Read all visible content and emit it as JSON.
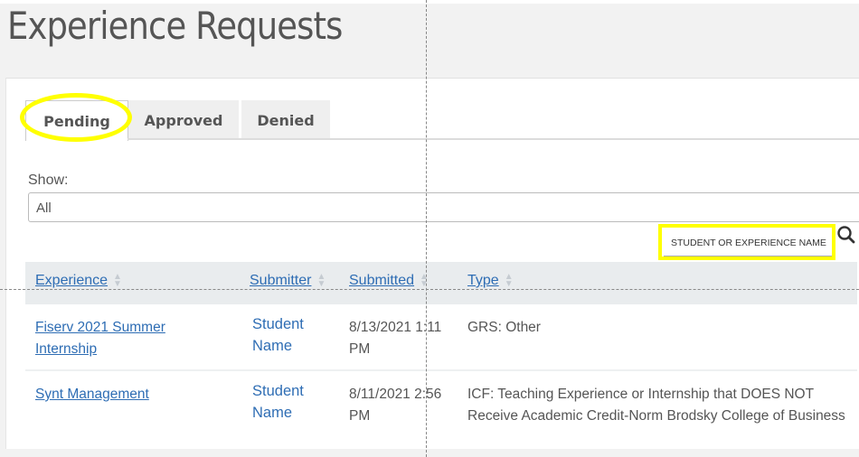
{
  "page": {
    "title": "Experience Requests"
  },
  "tabs": [
    {
      "label": "Pending",
      "active": true
    },
    {
      "label": "Approved",
      "active": false
    },
    {
      "label": "Denied",
      "active": false
    }
  ],
  "filter": {
    "label": "Show:",
    "selected": "All"
  },
  "search": {
    "placeholder": "STUDENT OR EXPERIENCE NAME",
    "icon": "search-icon"
  },
  "table": {
    "columns": [
      {
        "label": "Experience",
        "sortable": true
      },
      {
        "label": "Submitter",
        "sortable": true
      },
      {
        "label": "Submitted",
        "sortable": true
      },
      {
        "label": "Type",
        "sortable": true
      }
    ],
    "rows": [
      {
        "experience": "Fiserv 2021 Summer Internship",
        "submitter": "Student Name",
        "submitted": "8/13/2021 1:11 PM",
        "type": "GRS: Other"
      },
      {
        "experience": "Synt Management",
        "submitter": "Student Name",
        "submitted": "8/11/2021 2:56 PM",
        "type": "ICF: Teaching Experience or Internship that DOES NOT Receive Academic Credit-Norm Brodsky College of Business"
      }
    ]
  },
  "colors": {
    "link": "#2e6db4",
    "highlight": "#ffff00",
    "header_bg": "#e9ecee"
  }
}
